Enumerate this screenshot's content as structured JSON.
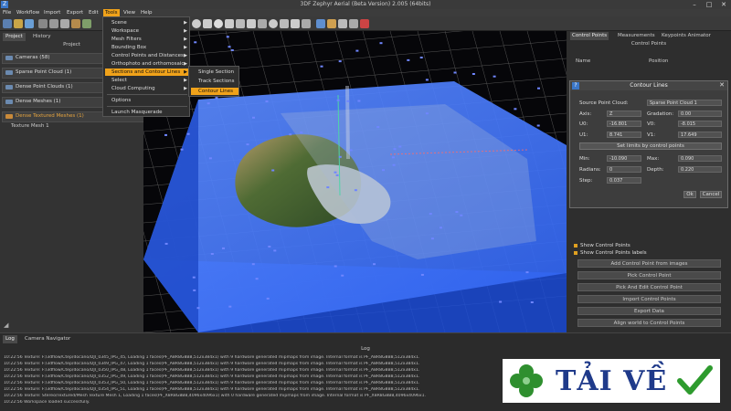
{
  "window": {
    "title": "3DF Zephyr Aerial (Beta Version) 2.005 (64bits)"
  },
  "menubar": [
    "File",
    "Workflow",
    "Import",
    "Export",
    "Edit",
    "Tools",
    "View",
    "Help"
  ],
  "tools_menu": {
    "items": [
      "Scene",
      "Workspace",
      "Mesh Filters",
      "Bounding Box",
      "Control Points and Distances",
      "Orthophoto and orthomosaic",
      "Sections and Contour Lines",
      "Select",
      "Cloud Computing",
      "Options",
      "Launch Masquerade"
    ],
    "sections_submenu": [
      "Single Section",
      "Track Sections",
      "Contour Lines"
    ]
  },
  "left_panel": {
    "tabs": [
      "Project",
      "History"
    ],
    "title": "Project",
    "items": [
      {
        "label": "Cameras (58)"
      },
      {
        "label": "Sparse Point Cloud (1)"
      },
      {
        "label": "Dense Point Clouds (1)"
      },
      {
        "label": "Dense Meshes (1)"
      },
      {
        "label": "Dense Textured Meshes (1)"
      }
    ],
    "sub_item": "Texture Mesh 1"
  },
  "right_panel": {
    "tabs": [
      "Control Points",
      "Measurements",
      "Keypoints Animator"
    ],
    "section_title": "Control Points",
    "columns": [
      "Name",
      "Position"
    ],
    "checkboxes": [
      "Show Control Points",
      "Show Control Points labels"
    ],
    "buttons": [
      "Add Control Point from images",
      "Pick Control Point",
      "Pick And Edit Control Point",
      "Import Control Points",
      "Export Data",
      "Align world to Control Points"
    ]
  },
  "contour_dialog": {
    "title": "Contour Lines",
    "source_label": "Source Point Cloud:",
    "source_value": "Sparse Point Cloud 1",
    "axis_label": "Axis:",
    "axis_value": "Z",
    "gradation_label": "Gradation:",
    "gradation_value": "0.00",
    "u0_label": "U0:",
    "u0_value": "-16.801",
    "v0_label": "V0:",
    "v0_value": "-8.015",
    "u1_label": "U1:",
    "u1_value": "8.741",
    "v1_label": "V1:",
    "v1_value": "17.649",
    "set_limits": "Set limits by control points",
    "min_label": "Min:",
    "min_value": "-10.090",
    "max_label": "Max:",
    "max_value": "0.090",
    "radians_label": "Radians:",
    "radians_value": "0",
    "depth_label": "Depth:",
    "depth_value": "0.220",
    "step_label": "Step:",
    "step_value": "0.037",
    "ok": "Ok",
    "cancel": "Cancel"
  },
  "log": {
    "tabs": [
      "Log",
      "Camera Navigator"
    ],
    "title": "Log",
    "lines": [
      "10:22:56 Texture: F:/3dflow/Ctep/docano/DJI_0345_IPG_45, Loading 1 faces(PF_A8R8G8B8,512x384x1) with 9 hardware generated mipmaps from image. Internal format is PF_A8R8G8B8,512x384x1.",
      "10:22:56 Texture: F:/3dflow/Ctep/docano/DJI_0349_IPG_47, Loading 1 faces(PF_A8R8G8B8,512x384x1) with 9 hardware generated mipmaps from image. Internal format is PF_A8R8G8B8,512x384x1.",
      "10:22:56 Texture: F:/3dflow/Ctep/docano/DJI_0350_IPG_48, Loading 1 faces(PF_A8R8G8B8,512x384x1) with 9 hardware generated mipmaps from image. Internal format is PF_A8R8G8B8,512x384x1.",
      "10:22:56 Texture: F:/3dflow/Ctep/docano/DJI_0352_IPG_49, Loading 1 faces(PF_A8R8G8B8,512x384x1) with 9 hardware generated mipmaps from image. Internal format is PF_A8R8G8B8,512x384x1.",
      "10:22:56 Texture: F:/3dflow/Ctep/docano/DJI_0353_IPG_50, Loading 1 faces(PF_A8R8G8B8,512x384x1) with 9 hardware generated mipmaps from image. Internal format is PF_A8R8G8B8,512x384x1.",
      "10:22:56 Texture: F:/3dflow/Ctep/docano/DJI_0354_IPG_51, Loading 1 faces(PF_A8R8G8B8,512x384x1) with 9 hardware generated mipmaps from image. Internal format is PF_A8R8G8B8,512x384x1.",
      "10:22:56 Texture: Stereo/Textured/Mesh Texture Mesh 1, Loading 1 faces(PF_X8R8G8B8,4096x4096x1) with 0 hardware generated mipmaps from image. Internal format is PF_X8R8G8B8,4096x4096x1.",
      "10:22:56 Workspace loaded successfully."
    ]
  },
  "watermark": {
    "text": "TẢI VỀ"
  },
  "colors": {
    "accent": "#f0a21a",
    "mesh_blue": "#2f6bff",
    "check_green": "#2e9b2e",
    "clover_green": "#2f8f2f"
  }
}
